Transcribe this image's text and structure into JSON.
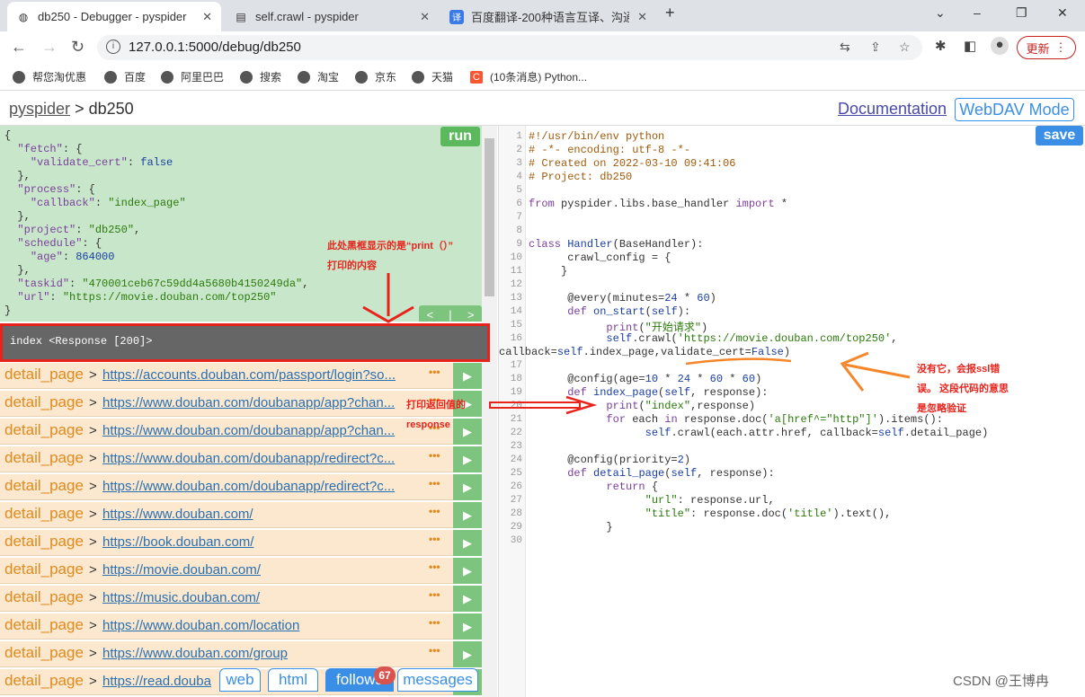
{
  "tabs": [
    {
      "label": "db250 - Debugger - pyspider",
      "icon": "globe-icon",
      "active": true
    },
    {
      "label": "self.crawl - pyspider",
      "icon": "doc-icon",
      "active": false
    },
    {
      "label": "百度翻译-200种语言互译、沟通全",
      "icon": "translate-icon",
      "active": false
    }
  ],
  "window_controls": {
    "minimize": "–",
    "maximize": "❐",
    "close": "✕",
    "new_tab": "+",
    "tab_menu": "⌄"
  },
  "address_bar": {
    "url": "127.0.0.1:5000/debug/db250",
    "update_label": "更新"
  },
  "bookmarks": [
    "帮您淘优惠",
    "百度",
    "阿里巴巴",
    "搜索",
    "淘宝",
    "京东",
    "天猫",
    "(10条消息) Python..."
  ],
  "header": {
    "root_link": "pyspider",
    "separator": ">",
    "project": "db250",
    "documentation": "Documentation",
    "webdav": "WebDAV Mode"
  },
  "task_panel": {
    "run_label": "run",
    "nav_prev": "<",
    "nav_sep": "|",
    "nav_next": ">",
    "json_lines": [
      "{",
      "  \"fetch\": {",
      "    \"validate_cert\": false",
      "  },",
      "  \"process\": {",
      "    \"callback\": \"index_page\"",
      "  },",
      "  \"project\": \"db250\",",
      "  \"schedule\": {",
      "    \"age\": 864000",
      "  },",
      "  \"taskid\": \"470001ceb67c59dd4a5680b4150249da\",",
      "  \"url\": \"https://movie.douban.com/top250\"",
      "}"
    ]
  },
  "output": {
    "text": "index <Response [200]>"
  },
  "follows": [
    {
      "callback": "detail_page",
      "url": "https://accounts.douban.com/passport/login?so..."
    },
    {
      "callback": "detail_page",
      "url": "https://www.douban.com/doubanapp/app?chan..."
    },
    {
      "callback": "detail_page",
      "url": "https://www.douban.com/doubanapp/app?chan..."
    },
    {
      "callback": "detail_page",
      "url": "https://www.douban.com/doubanapp/redirect?c..."
    },
    {
      "callback": "detail_page",
      "url": "https://www.douban.com/doubanapp/redirect?c..."
    },
    {
      "callback": "detail_page",
      "url": "https://www.douban.com/"
    },
    {
      "callback": "detail_page",
      "url": "https://book.douban.com/"
    },
    {
      "callback": "detail_page",
      "url": "https://movie.douban.com/"
    },
    {
      "callback": "detail_page",
      "url": "https://music.douban.com/"
    },
    {
      "callback": "detail_page",
      "url": "https://www.douban.com/location"
    },
    {
      "callback": "detail_page",
      "url": "https://www.douban.com/group"
    },
    {
      "callback": "detail_page",
      "url": "https://read.douba"
    }
  ],
  "follow_row_gt": ">",
  "follow_row_dots": "•••",
  "follow_row_play": "▶",
  "bottom_tabs": {
    "web": "web",
    "html": "html",
    "follows": "follows",
    "follows_count": "67",
    "messages": "messages"
  },
  "editor": {
    "save_label": "save",
    "line_numbers": [
      "1",
      "2",
      "3",
      "4",
      "5",
      "6",
      "7",
      "8",
      "9",
      "10",
      "11",
      "12",
      "13",
      "14",
      "15",
      "16",
      "",
      "17",
      "18",
      "19",
      "20",
      "21",
      "22",
      "23",
      "24",
      "25",
      "26",
      "27",
      "28",
      "29",
      "30"
    ]
  },
  "annotations": {
    "console_note_1": "此处黑框显示的是“print（）”",
    "console_note_2": "打印的内容",
    "response_note_1": "打印返回值的",
    "response_note_2": "response",
    "ssl_note_1": "没有它，会报ssl错",
    "ssl_note_2": "误。 这段代码的意思",
    "ssl_note_3": "是忽略验证"
  },
  "watermark": "CSDN @王博冉",
  "colors": {
    "red_annotation": "#e8231b",
    "orange_arrow": "#f5862a",
    "run_green": "#5cb85c",
    "save_blue": "#3a8ee6"
  }
}
